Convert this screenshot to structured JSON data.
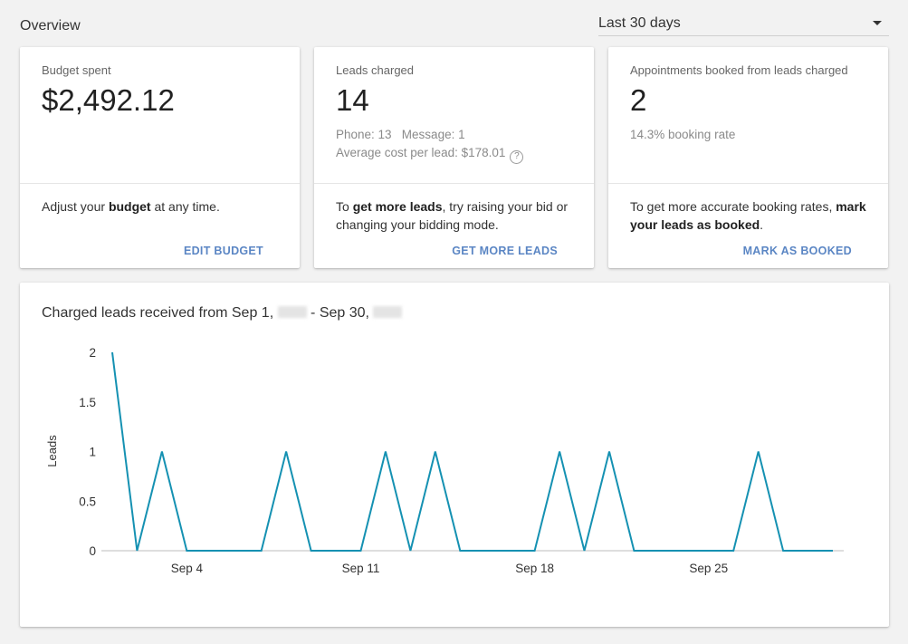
{
  "overview": {
    "title": "Overview"
  },
  "range": {
    "selected": "Last 30 days"
  },
  "cards": {
    "budget": {
      "label": "Budget spent",
      "value": "$2,492.12",
      "msg_pre": "Adjust your ",
      "msg_bold": "budget",
      "msg_post": " at any time.",
      "action": "EDIT BUDGET"
    },
    "leads": {
      "label": "Leads charged",
      "value": "14",
      "sub1": "Phone: 13   Message: 1",
      "sub2": "Average cost per lead: $178.01",
      "msg_pre": "To ",
      "msg_bold": "get more leads",
      "msg_post": ", try raising your bid or changing your bidding mode.",
      "action": "GET MORE LEADS"
    },
    "appointments": {
      "label": "Appointments booked from leads charged",
      "value": "2",
      "sub1": "14.3% booking rate",
      "msg_pre": "To get more accurate booking rates, ",
      "msg_bold": "mark your leads as booked",
      "msg_post": ".",
      "action": "MARK AS BOOKED"
    }
  },
  "chart": {
    "title_part1": "Charged leads received from Sep 1, ",
    "title_part2": " - Sep 30, "
  },
  "chart_data": {
    "type": "line",
    "title": "Charged leads received from Sep 1, - Sep 30,",
    "xlabel": "",
    "ylabel": "Leads",
    "x": [
      1,
      2,
      3,
      4,
      5,
      6,
      7,
      8,
      9,
      10,
      11,
      12,
      13,
      14,
      15,
      16,
      17,
      18,
      19,
      20,
      21,
      22,
      23,
      24,
      25,
      26,
      27,
      28,
      29,
      30
    ],
    "series": [
      {
        "values": [
          2,
          0,
          1,
          0,
          0,
          0,
          0,
          1,
          0,
          0,
          0,
          1,
          0,
          1,
          0,
          0,
          0,
          0,
          1,
          0,
          1,
          0,
          0,
          0,
          0,
          0,
          1,
          0,
          0,
          0
        ]
      }
    ],
    "x_ticks": [
      {
        "x": 4,
        "label": "Sep 4"
      },
      {
        "x": 11,
        "label": "Sep 11"
      },
      {
        "x": 18,
        "label": "Sep 18"
      },
      {
        "x": 25,
        "label": "Sep 25"
      }
    ],
    "y_ticks": [
      "0",
      "0.5",
      "1",
      "1.5",
      "2"
    ],
    "ylim": [
      0,
      2
    ],
    "grid": false,
    "line_color": "#1591b2"
  }
}
